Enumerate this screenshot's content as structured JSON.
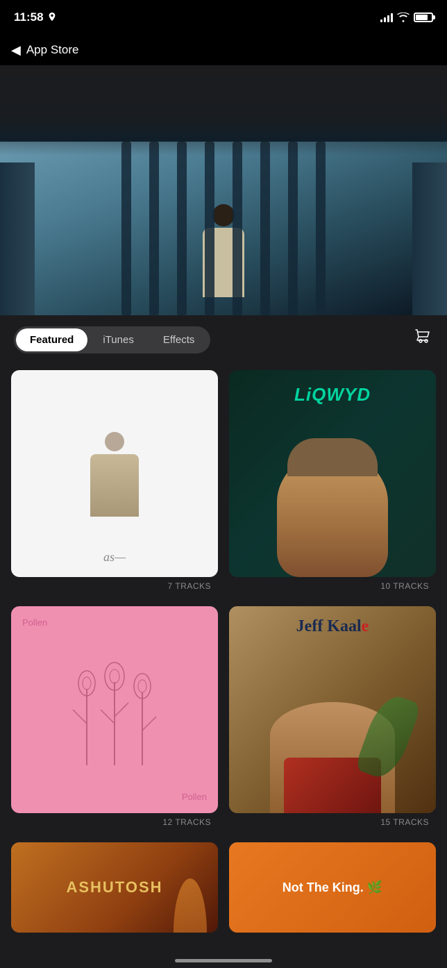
{
  "status": {
    "time": "11:58",
    "back_label": "App Store"
  },
  "tabs": {
    "featured_label": "Featured",
    "itunes_label": "iTunes",
    "effects_label": "Effects",
    "active": "featured"
  },
  "albums": [
    {
      "id": "album-1",
      "signature": "as—",
      "track_count": "7 TRACKS",
      "style": "white-minimal"
    },
    {
      "id": "album-2",
      "title": "LiQWYD",
      "track_count": "10 TRACKS",
      "style": "liqwyd-green"
    },
    {
      "id": "album-3",
      "label_top": "Pollen",
      "label_bottom": "Pollen",
      "track_count": "12 TRACKS",
      "style": "pollen-pink"
    },
    {
      "id": "album-4",
      "artist_first": "Jeff Kaal",
      "artist_highlight": "e",
      "track_count": "15 TRACKS",
      "style": "jeff-kaale"
    }
  ],
  "bottom_albums": [
    {
      "id": "ashutosh",
      "title": "ASHUTOSH",
      "style": "warm-orange"
    },
    {
      "id": "not-the-king",
      "title": "Not The King. 🌿",
      "style": "orange"
    }
  ]
}
